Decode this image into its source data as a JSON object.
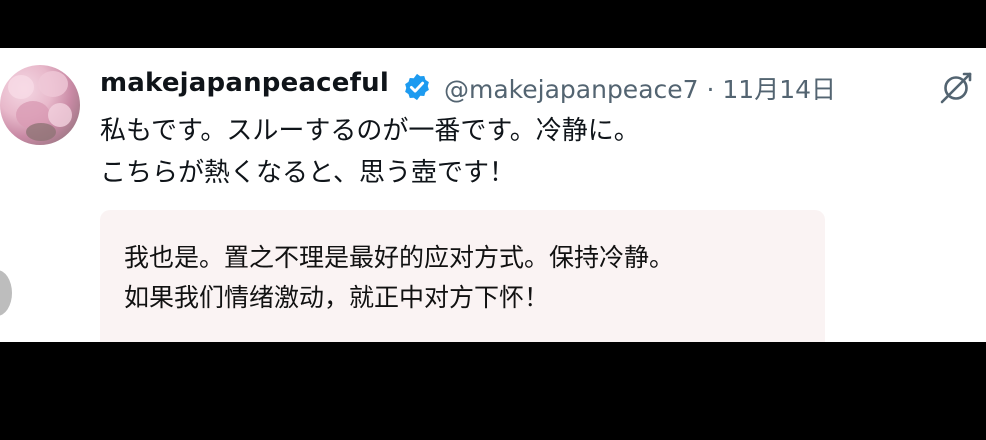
{
  "tweet": {
    "username": "makejapanpeaceful",
    "handle_time": "@makejapanpeace7 · 11月14日",
    "text_line1": "私もです。スルーするのが一番です。冷静に。",
    "text_line2": "こちらが熱くなると、思う壺です！",
    "verified": true,
    "badge_color": "#1d9bf0"
  },
  "translation": {
    "line1": "我也是。置之不理是最好的应对方式。保持冷静。",
    "line2": "如果我们情绪激动，就正中对方下怀！"
  },
  "icons": {
    "avatar": "avatar",
    "verified": "verified-badge-icon",
    "grok": "grok-icon",
    "scroll": "scroll-handle"
  }
}
